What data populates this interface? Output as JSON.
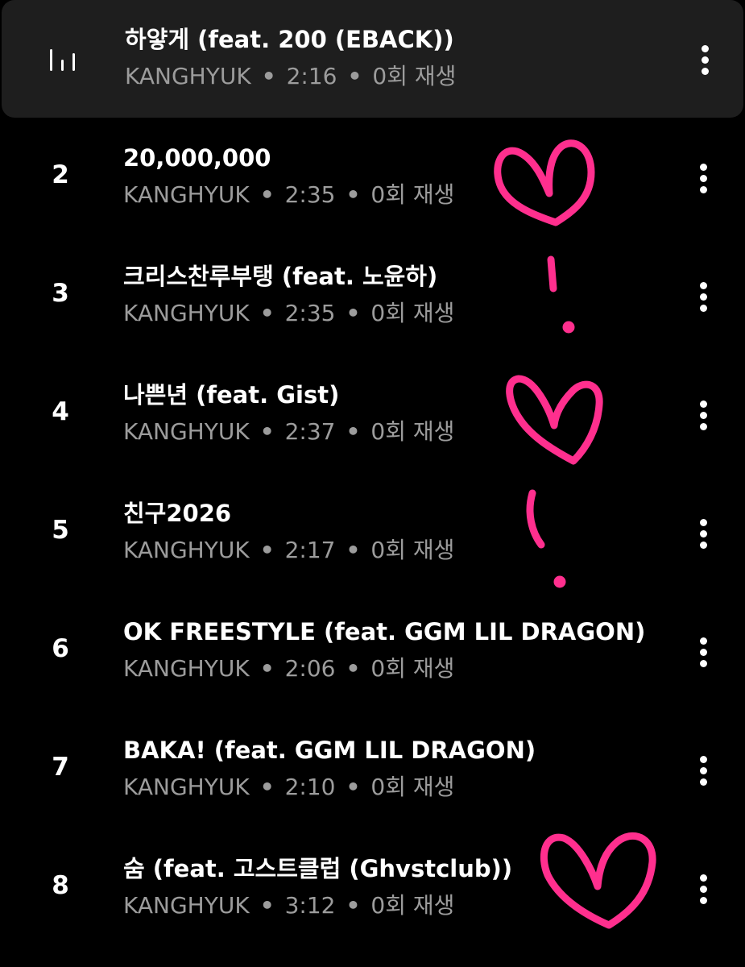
{
  "colors": {
    "background": "#000000",
    "playing_row_background": "#1e1e1e",
    "title_text": "#ffffff",
    "meta_text": "#9c9c9c",
    "doodle": "#ff2f8e"
  },
  "icons": {
    "now_playing": "equalizer-bars-icon",
    "more": "more-vertical-icon"
  },
  "tracks": [
    {
      "index": "1",
      "title": "하얗게 (feat. 200 (EBACK))",
      "artist": "KANGHYUK",
      "sep1": "•",
      "duration": "2:16",
      "sep2": "•",
      "plays": "0회 재생",
      "now_playing": true
    },
    {
      "index": "2",
      "title": "20,000,000",
      "artist": "KANGHYUK",
      "sep1": "•",
      "duration": "2:35",
      "sep2": "•",
      "plays": "0회 재생"
    },
    {
      "index": "3",
      "title": "크리스찬루부탱 (feat. 노윤하)",
      "artist": "KANGHYUK",
      "sep1": "•",
      "duration": "2:35",
      "sep2": "•",
      "plays": "0회 재생"
    },
    {
      "index": "4",
      "title": "나쁜년 (feat. Gist)",
      "artist": "KANGHYUK",
      "sep1": "•",
      "duration": "2:37",
      "sep2": "•",
      "plays": "0회 재생"
    },
    {
      "index": "5",
      "title": "친구2026",
      "artist": "KANGHYUK",
      "sep1": "•",
      "duration": "2:17",
      "sep2": "•",
      "plays": "0회 재생"
    },
    {
      "index": "6",
      "title": "OK FREESTYLE (feat. GGM LIL DRAGON)",
      "artist": "KANGHYUK",
      "sep1": "•",
      "duration": "2:06",
      "sep2": "•",
      "plays": "0회 재생"
    },
    {
      "index": "7",
      "title": "BAKA! (feat. GGM LIL DRAGON)",
      "artist": "KANGHYUK",
      "sep1": "•",
      "duration": "2:10",
      "sep2": "•",
      "plays": "0회 재생"
    },
    {
      "index": "8",
      "title": "숨 (feat. 고스트클럽 (Ghvstclub))",
      "artist": "KANGHYUK",
      "sep1": "•",
      "duration": "3:12",
      "sep2": "•",
      "plays": "0회 재생"
    }
  ]
}
